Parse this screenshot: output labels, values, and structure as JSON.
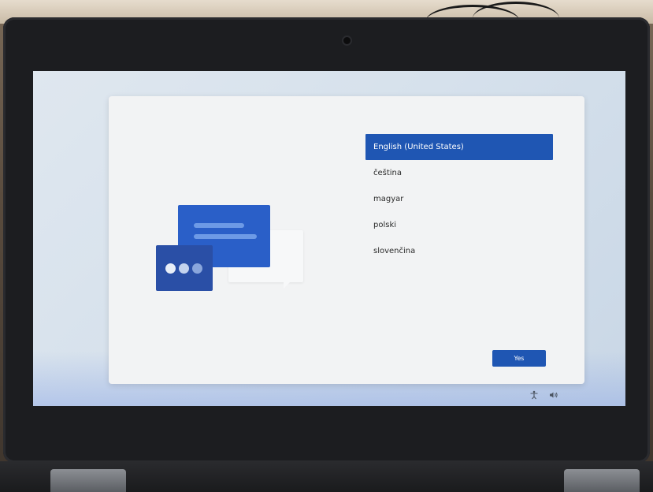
{
  "languages": {
    "items": [
      {
        "label": "English (United States)",
        "selected": true
      },
      {
        "label": "čeština",
        "selected": false
      },
      {
        "label": "magyar",
        "selected": false
      },
      {
        "label": "polski",
        "selected": false
      },
      {
        "label": "slovenčina",
        "selected": false
      }
    ]
  },
  "actions": {
    "yes_label": "Yes"
  },
  "tray": {
    "accessibility_icon": "accessibility-icon",
    "volume_icon": "volume-icon"
  },
  "colors": {
    "accent": "#1f56b3",
    "bubble_blue": "#2a5fc8",
    "bubble_dark": "#2a4fa6",
    "card": "#f2f3f4"
  }
}
